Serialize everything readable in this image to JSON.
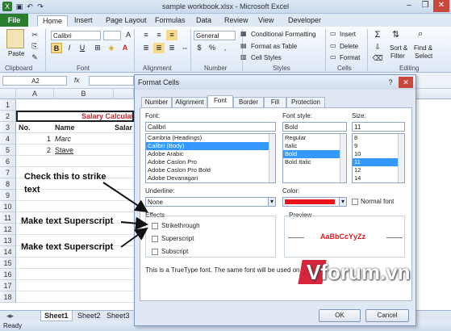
{
  "window": {
    "title": "sample workbook.xlsx  -  Microsoft Excel",
    "minimize": "–",
    "restore": "❐",
    "close": "✕"
  },
  "ribbon": {
    "file_tab": "File",
    "tabs": [
      "Home",
      "Insert",
      "Page Layout",
      "Formulas",
      "Data",
      "Review",
      "View",
      "Developer"
    ],
    "clipboard": {
      "paste": "Paste",
      "label": "Clipboard"
    },
    "font": {
      "name": "Calibri",
      "bold": "B",
      "italic": "I",
      "underline": "U",
      "grow": "A",
      "label": "Font"
    },
    "alignment": {
      "label": "Alignment"
    },
    "number": {
      "format": "General",
      "currency": "$",
      "percent": "%",
      "comma": ",",
      "label": "Number"
    },
    "styles": {
      "conditional": "Conditional Formatting",
      "table": "Format as Table",
      "cell_styles": "Cell Styles",
      "label": "Styles"
    },
    "cells": {
      "insert": "Insert",
      "delete": "Delete",
      "format": "Format",
      "label": "Cells"
    },
    "editing": {
      "sum": "Σ",
      "sort": "Sort &",
      "sort2": "Filter",
      "find": "Find &",
      "find2": "Select",
      "label": "Editing"
    }
  },
  "formula_bar": {
    "name_box": "A2",
    "fx": "fx"
  },
  "sheet": {
    "columns": [
      "A",
      "B"
    ],
    "rows": [
      "1",
      "2",
      "3",
      "4",
      "5",
      "6",
      "7",
      "8",
      "9",
      "10",
      "11",
      "12",
      "13",
      "14",
      "15",
      "16",
      "17",
      "18"
    ],
    "title_cell": "Salary Calculatio",
    "header_no": "No.",
    "header_name": "Name",
    "header_salary": "Salar",
    "row4": {
      "no": "1",
      "name": "Marc"
    },
    "row5": {
      "no": "2",
      "name": "Stave"
    },
    "tabs": [
      "Sheet1",
      "Sheet2",
      "Sheet3"
    ],
    "status": "Ready"
  },
  "dialog": {
    "title": "Format Cells",
    "help": "?",
    "close": "✕",
    "tabs": [
      "Number",
      "Alignment",
      "Font",
      "Border",
      "Fill",
      "Protection"
    ],
    "font_label": "Font:",
    "font_value": "Calibri",
    "font_list": [
      "Cambria (Headings)",
      "Calibri (Body)",
      "Adobe Arabic",
      "Adobe Caslon Pro",
      "Adobe Caslon Pro Bold",
      "Adobe Devanagari"
    ],
    "style_label": "Font style:",
    "style_value": "Bold",
    "style_list": [
      "Regular",
      "Italic",
      "Bold",
      "Bold Italic"
    ],
    "size_label": "Size:",
    "size_value": "11",
    "size_list": [
      "8",
      "9",
      "10",
      "11",
      "12",
      "14"
    ],
    "underline_label": "Underline:",
    "underline_value": "None",
    "color_label": "Color:",
    "color_value": "#e8161b",
    "normal_font": "Normal font",
    "effects_label": "Effects",
    "strikethrough": "Strikethrough",
    "superscript": "Superscript",
    "subscript": "Subscript",
    "preview_label": "Preview",
    "preview_text": "AaBbCcYyZz",
    "footnote": "This is a TrueType font.  The same font will be used on bot",
    "ok": "OK",
    "cancel": "Cancel"
  },
  "annotations": {
    "strike": "Check this to strike\ntext",
    "super1": "Make text Superscript",
    "super2": "Make text Superscript"
  },
  "watermark": "Vforum.vn"
}
